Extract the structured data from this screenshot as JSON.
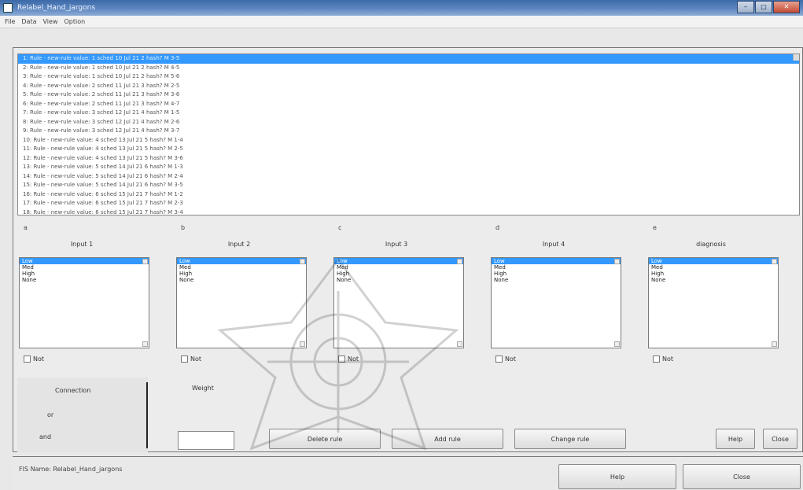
{
  "window": {
    "title": "Relabel_Hand_jargons"
  },
  "menu": [
    "File",
    "Data",
    "View",
    "Option"
  ],
  "rules_list": {
    "lines": [
      "1: Rule - new-rule value: 1 sched 10 Jul 21 2 hash? M 3-5",
      "2: Rule - new-rule value: 1 sched 10 Jul 21 2 hash? M 4-5",
      "3: Rule - new-rule value: 1 sched 10 Jul 21 2 hash? M 5-6",
      "4: Rule - new-rule value: 2 sched 11 Jul 21 3 hash? M 2-5",
      "5: Rule - new-rule value: 2 sched 11 Jul 21 3 hash? M 3-6",
      "6: Rule - new-rule value: 2 sched 11 Jul 21 3 hash? M 4-7",
      "7: Rule - new-rule value: 3 sched 12 Jul 21 4 hash? M 1-5",
      "8: Rule - new-rule value: 3 sched 12 Jul 21 4 hash? M 2-6",
      "9: Rule - new-rule value: 3 sched 12 Jul 21 4 hash? M 3-7",
      "10: Rule - new-rule value: 4 sched 13 Jul 21 5 hash? M 1-4",
      "11: Rule - new-rule value: 4 sched 13 Jul 21 5 hash? M 2-5",
      "12: Rule - new-rule value: 4 sched 13 Jul 21 5 hash? M 3-6",
      "13: Rule - new-rule value: 5 sched 14 Jul 21 6 hash? M 1-3",
      "14: Rule - new-rule value: 5 sched 14 Jul 21 6 hash? M 2-4",
      "15: Rule - new-rule value: 5 sched 14 Jul 21 6 hash? M 3-5",
      "16: Rule - new-rule value: 6 sched 15 Jul 21 7 hash? M 1-2",
      "17: Rule - new-rule value: 6 sched 15 Jul 21 7 hash? M 2-3",
      "18: Rule - new-rule value: 6 sched 15 Jul 21 7 hash? M 3-4"
    ]
  },
  "columns": [
    {
      "tag": "a",
      "title": "Input 1",
      "items": [
        "Low",
        "Med",
        "High",
        "None"
      ],
      "check_label": "Not"
    },
    {
      "tag": "b",
      "title": "Input 2",
      "items": [
        "Low",
        "Med",
        "High",
        "None"
      ],
      "check_label": "Not"
    },
    {
      "tag": "c",
      "title": "Input 3",
      "items": [
        "Low",
        "Med",
        "High",
        "None"
      ],
      "check_label": "Not"
    },
    {
      "tag": "d",
      "title": "Input 4",
      "items": [
        "Low",
        "Med",
        "High",
        "None"
      ],
      "check_label": "Not"
    },
    {
      "tag": "e",
      "title": "diagnosis",
      "items": [
        "Low",
        "Med",
        "High",
        "None"
      ],
      "check_label": "Not"
    }
  ],
  "lower": {
    "connection_label": "Connection",
    "or_label": "or",
    "and_label": "and",
    "weight_label": "Weight",
    "buttons": {
      "delete": "Delete rule",
      "add": "Add rule",
      "change": "Change rule",
      "help": "Help",
      "close_small": "Close"
    }
  },
  "status": {
    "text": "FIS Name: Relabel_Hand_jargons",
    "help": "Help",
    "close": "Close"
  }
}
